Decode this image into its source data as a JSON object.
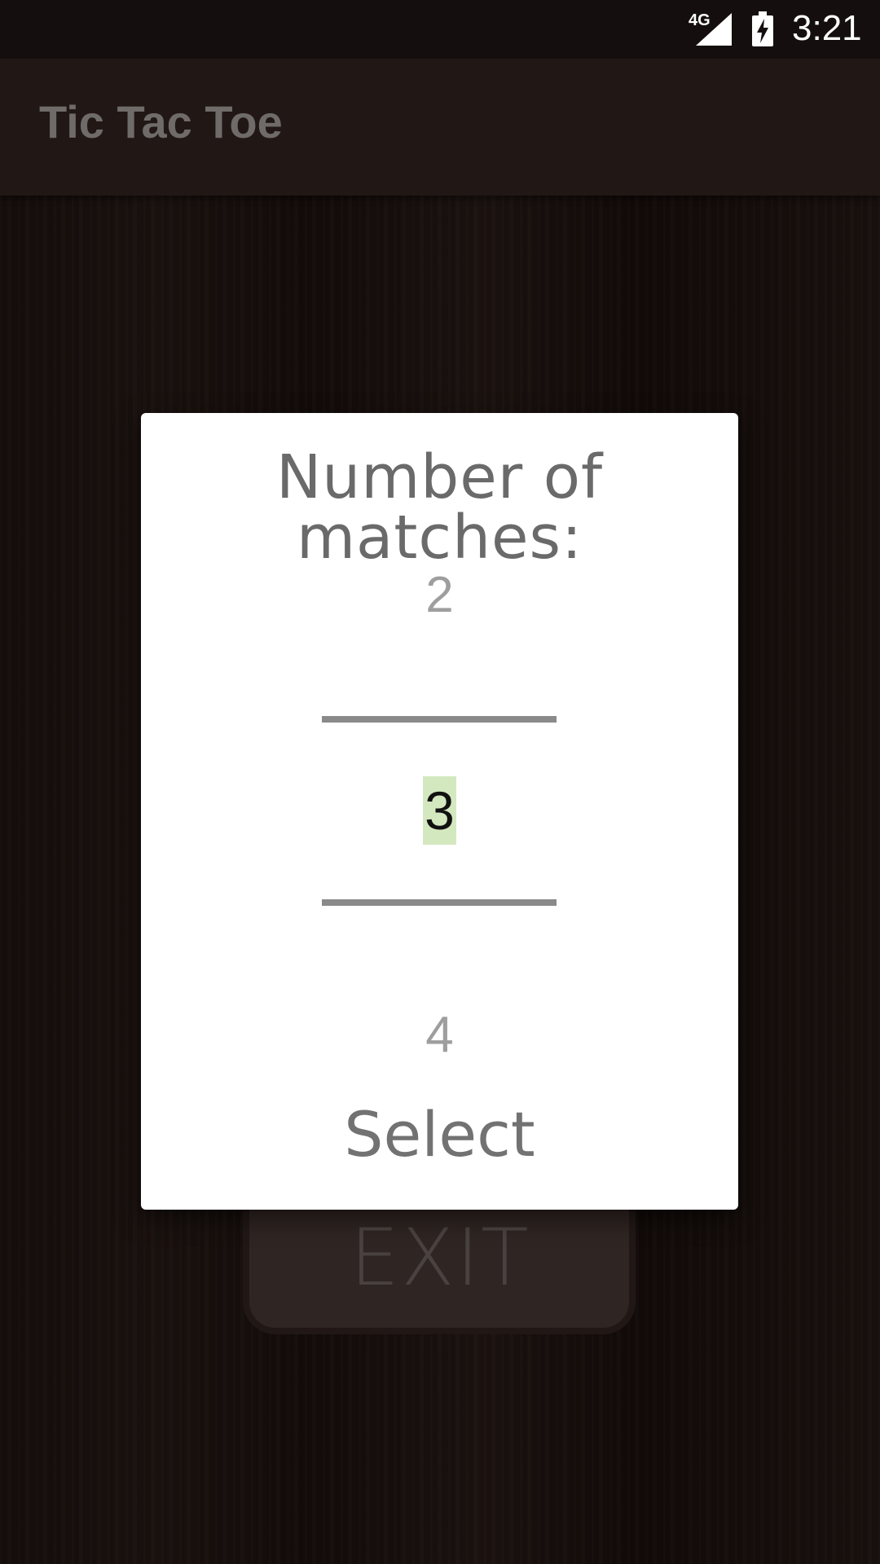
{
  "status_bar": {
    "network": "4G",
    "time": "3:21",
    "icons": [
      "signal-icon",
      "battery-charging-icon"
    ]
  },
  "app_bar": {
    "title": "Tic Tac Toe"
  },
  "background_button": {
    "label": "EXIT"
  },
  "dialog": {
    "title": "Number of matches:",
    "picker": {
      "previous": "2",
      "selected": "3",
      "next": "4"
    },
    "select_label": "Select"
  },
  "colors": {
    "highlight": "#d4e8bf",
    "dialog_bg": "#ffffff",
    "app_bar_bg": "#211816"
  }
}
